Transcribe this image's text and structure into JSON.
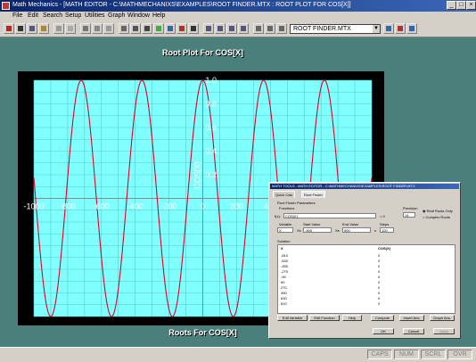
{
  "window": {
    "title": "Math Mechanics - [MATH EDITOR - C:\\MATHMECHANIXS\\EXAMPLES\\ROOT FINDER.MTX : ROOT PLOT FOR COS[X]]"
  },
  "menu": [
    "File",
    "Edit",
    "Search",
    "Setup",
    "Utilities",
    "Graph",
    "Window",
    "Help"
  ],
  "toolbar": {
    "file_combo": "ROOT FINDER.MTX"
  },
  "plot": {
    "title": "Root Plot For COS[X]",
    "subtitle": "Roots For COS[X]",
    "ylabel": "COS[X]"
  },
  "chart_data": {
    "type": "line",
    "title": "Root Plot For COS[X]",
    "xlabel": "Roots For COS[X]",
    "ylabel": "COS[X]",
    "xlim": [
      -1000,
      1000
    ],
    "ylim": [
      -1,
      1
    ],
    "x_ticks": [
      -1000,
      -800,
      -600,
      -400,
      -200,
      0,
      200,
      400
    ],
    "y_ticks": [
      "1.0",
      "0.8",
      "0.6",
      "0.4",
      "0.2"
    ],
    "function": "cos(x) with x in degrees",
    "background": "#80ffff",
    "series_color": "#e0002a",
    "grid": true
  },
  "status": {
    "caps": "CAPS",
    "num": "NUM",
    "scrl": "SCRL",
    "ovr": "OVR"
  },
  "dialog": {
    "title": "MATH TOOLS - MATH EDITOR - C:\\MATHMECHANIXS\\EXAMPLES\\ROOT FINDER.MTX",
    "tabs": [
      "Quick Calc",
      "Root Finder"
    ],
    "group_label": "Root Finder Parameters",
    "functions_label": "Functions",
    "fx_label": "f(x):",
    "fx_value": "COS[X]",
    "eq_zero": "= 0",
    "precision_label": "Precision",
    "precision_value": "14",
    "radio_real": "Real Roots Only",
    "radio_complex": "Complex Roots",
    "variable_label": "Variable",
    "variable_value": "X",
    "start_label": "Start Value",
    "start_value": "-900",
    "end_label": "End Value",
    "end_value": "900",
    "steps_label": "Steps",
    "steps_value": "100",
    "solution_label": "Solution",
    "col_x": "X",
    "col_fx": "COS(X)",
    "rows": [
      {
        "x": "-810",
        "fx": "0"
      },
      {
        "x": "-630",
        "fx": "0"
      },
      {
        "x": "-450",
        "fx": "0"
      },
      {
        "x": "-270",
        "fx": "0"
      },
      {
        "x": "-90",
        "fx": "0"
      },
      {
        "x": "90",
        "fx": "0"
      },
      {
        "x": "270",
        "fx": "0"
      },
      {
        "x": "450",
        "fx": "0"
      },
      {
        "x": "630",
        "fx": "0"
      },
      {
        "x": "810",
        "fx": "0"
      }
    ],
    "buttons": [
      "Edit Variable",
      "Edit Function",
      "Help",
      "Compute",
      "Insert Ans.",
      "Graph Ans."
    ],
    "ok": "OK",
    "cancel": "Cancel",
    "apply": "Apply"
  }
}
